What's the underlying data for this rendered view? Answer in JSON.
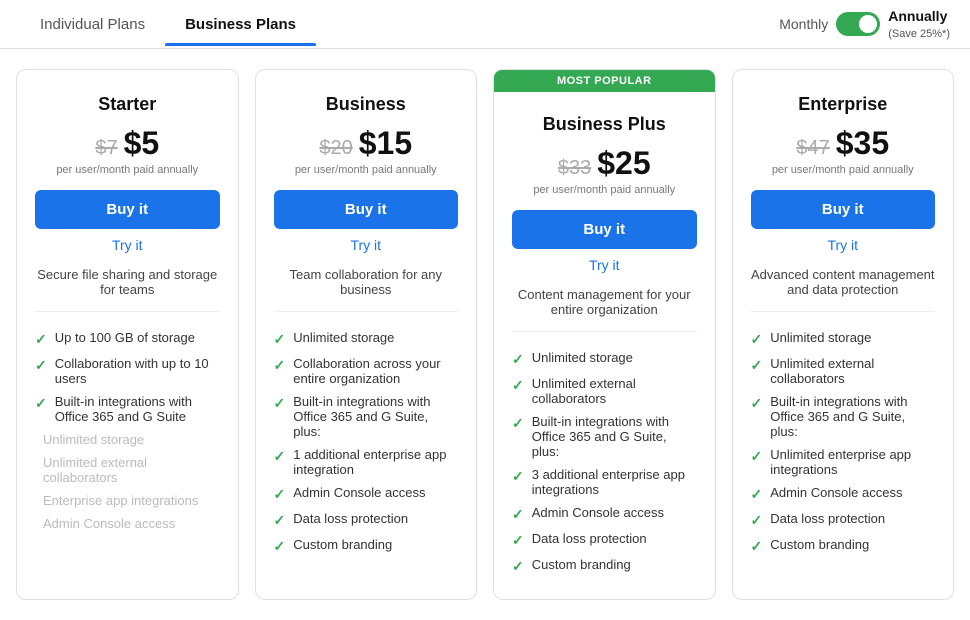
{
  "tabs": [
    {
      "id": "individual",
      "label": "Individual Plans",
      "active": false
    },
    {
      "id": "business",
      "label": "Business Plans",
      "active": true
    }
  ],
  "billing": {
    "monthly_label": "Monthly",
    "annually_label": "Annually",
    "save_label": "(Save 25%*)"
  },
  "plans": [
    {
      "id": "starter",
      "name": "Starter",
      "popular": false,
      "old_price": "$7",
      "new_price": "$5",
      "price_note": "per user/month paid annually",
      "buy_label": "Buy it",
      "try_label": "Try it",
      "description": "Secure file sharing and storage for teams",
      "features": [
        {
          "text": "Up to 100 GB of storage",
          "enabled": true
        },
        {
          "text": "Collaboration with up to 10 users",
          "enabled": true
        },
        {
          "text": "Built-in integrations with Office 365 and G Suite",
          "enabled": true
        },
        {
          "text": "Unlimited storage",
          "enabled": false
        },
        {
          "text": "Unlimited external collaborators",
          "enabled": false
        },
        {
          "text": "Enterprise app integrations",
          "enabled": false
        },
        {
          "text": "Admin Console access",
          "enabled": false
        }
      ]
    },
    {
      "id": "business",
      "name": "Business",
      "popular": false,
      "old_price": "$20",
      "new_price": "$15",
      "price_note": "per user/month paid annually",
      "buy_label": "Buy it",
      "try_label": "Try it",
      "description": "Team collaboration for any business",
      "features": [
        {
          "text": "Unlimited storage",
          "enabled": true
        },
        {
          "text": "Collaboration across your entire organization",
          "enabled": true
        },
        {
          "text": "Built-in integrations with Office 365 and G Suite, plus:",
          "enabled": true
        },
        {
          "text": "1 additional enterprise app integration",
          "enabled": true
        },
        {
          "text": "Admin Console access",
          "enabled": true
        },
        {
          "text": "Data loss protection",
          "enabled": true
        },
        {
          "text": "Custom branding",
          "enabled": true
        }
      ]
    },
    {
      "id": "business-plus",
      "name": "Business Plus",
      "popular": true,
      "popular_label": "MOST POPULAR",
      "old_price": "$33",
      "new_price": "$25",
      "price_note": "per user/month paid annually",
      "buy_label": "Buy it",
      "try_label": "Try it",
      "description": "Content management for your entire organization",
      "features": [
        {
          "text": "Unlimited storage",
          "enabled": true
        },
        {
          "text": "Unlimited external collaborators",
          "enabled": true
        },
        {
          "text": "Built-in integrations with Office 365 and G Suite, plus:",
          "enabled": true
        },
        {
          "text": "3 additional enterprise app integrations",
          "enabled": true
        },
        {
          "text": "Admin Console access",
          "enabled": true
        },
        {
          "text": "Data loss protection",
          "enabled": true
        },
        {
          "text": "Custom branding",
          "enabled": true
        }
      ]
    },
    {
      "id": "enterprise",
      "name": "Enterprise",
      "popular": false,
      "old_price": "$47",
      "new_price": "$35",
      "price_note": "per user/month paid annually",
      "buy_label": "Buy it",
      "try_label": "Try it",
      "description": "Advanced content management and data protection",
      "features": [
        {
          "text": "Unlimited storage",
          "enabled": true
        },
        {
          "text": "Unlimited external collaborators",
          "enabled": true
        },
        {
          "text": "Built-in integrations with Office 365 and G Suite, plus:",
          "enabled": true
        },
        {
          "text": "Unlimited enterprise app integrations",
          "enabled": true
        },
        {
          "text": "Admin Console access",
          "enabled": true
        },
        {
          "text": "Data loss protection",
          "enabled": true
        },
        {
          "text": "Custom branding",
          "enabled": true
        }
      ]
    }
  ]
}
